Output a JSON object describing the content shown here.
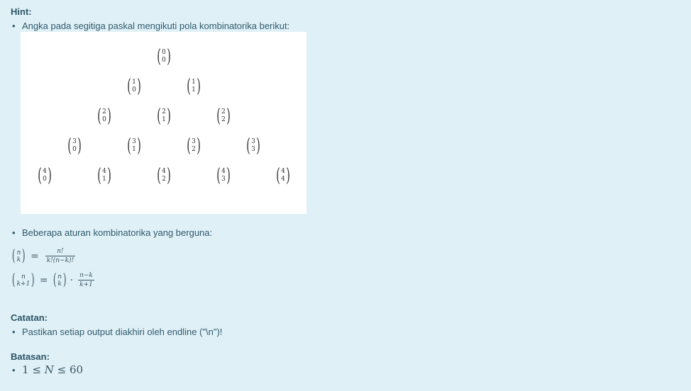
{
  "hint": {
    "heading": "Hint:",
    "bullet1": "Angka pada segitiga paskal mengikuti pola kombinatorika berikut:",
    "triangle": [
      [
        {
          "n": "0",
          "k": "0"
        }
      ],
      [
        {
          "n": "1",
          "k": "0"
        },
        {
          "n": "1",
          "k": "1"
        }
      ],
      [
        {
          "n": "2",
          "k": "0"
        },
        {
          "n": "2",
          "k": "1"
        },
        {
          "n": "2",
          "k": "2"
        }
      ],
      [
        {
          "n": "3",
          "k": "0"
        },
        {
          "n": "3",
          "k": "1"
        },
        {
          "n": "3",
          "k": "2"
        },
        {
          "n": "3",
          "k": "3"
        }
      ],
      [
        {
          "n": "4",
          "k": "0"
        },
        {
          "n": "4",
          "k": "1"
        },
        {
          "n": "4",
          "k": "2"
        },
        {
          "n": "4",
          "k": "3"
        },
        {
          "n": "4",
          "k": "4"
        }
      ]
    ],
    "bullet2": "Beberapa aturan kombinatorika yang berguna:",
    "formula1": {
      "top": "n",
      "bottom": "k",
      "eq": "=",
      "num": "n!",
      "den": "k!(n−k)!"
    },
    "formula2": {
      "top": "n",
      "bottom": "k+1",
      "eq": "=",
      "top2": "n",
      "bottom2": "k",
      "dot": "·",
      "num": "n−k",
      "den": "k+1"
    }
  },
  "catatan": {
    "heading": "Catatan:",
    "bullet": "Pastikan setiap output diakhiri oleh endline (\"\\n\")!"
  },
  "batasan": {
    "heading": "Batasan:",
    "lo": "1",
    "le1": "≤",
    "var": "N",
    "le2": "≤",
    "hi": "60"
  }
}
